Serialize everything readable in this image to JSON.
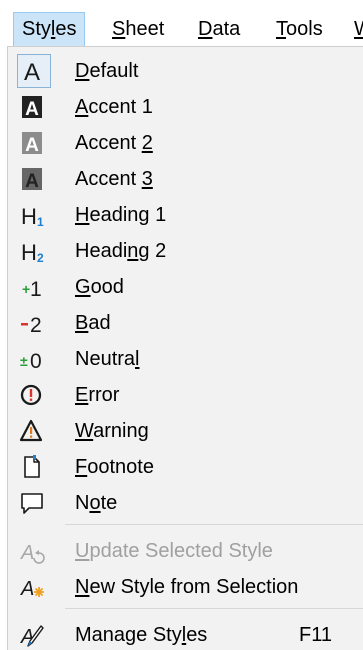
{
  "menubar": {
    "items": [
      {
        "pre": "Sty",
        "u": "l",
        "post": "es"
      },
      {
        "pre": "",
        "u": "S",
        "post": "heet"
      },
      {
        "pre": "",
        "u": "D",
        "post": "ata"
      },
      {
        "pre": "",
        "u": "T",
        "post": "ools"
      },
      {
        "pre": "",
        "u": "W",
        "post": ""
      }
    ]
  },
  "menu": {
    "items": [
      {
        "pre": "",
        "u": "D",
        "post": "efault",
        "icon": "default-style-icon"
      },
      {
        "pre": "",
        "u": "A",
        "post": "ccent 1",
        "icon": "accent1-style-icon"
      },
      {
        "pre": "Accent ",
        "u": "2",
        "post": "",
        "icon": "accent2-style-icon"
      },
      {
        "pre": "Accent ",
        "u": "3",
        "post": "",
        "icon": "accent3-style-icon"
      },
      {
        "pre": "",
        "u": "H",
        "post": "eading 1",
        "icon": "heading1-icon"
      },
      {
        "pre": "Headi",
        "u": "n",
        "post": "g 2",
        "icon": "heading2-icon"
      },
      {
        "pre": "",
        "u": "G",
        "post": "ood",
        "icon": "good-icon"
      },
      {
        "pre": "",
        "u": "B",
        "post": "ad",
        "icon": "bad-icon"
      },
      {
        "pre": "Neutra",
        "u": "l",
        "post": "",
        "icon": "neutral-icon"
      },
      {
        "pre": "",
        "u": "E",
        "post": "rror",
        "icon": "error-icon"
      },
      {
        "pre": "",
        "u": "W",
        "post": "arning",
        "icon": "warning-icon"
      },
      {
        "pre": "",
        "u": "F",
        "post": "ootnote",
        "icon": "footnote-icon"
      },
      {
        "pre": "N",
        "u": "o",
        "post": "te",
        "icon": "note-icon"
      },
      {
        "pre": "",
        "u": "U",
        "post": "pdate Selected Style",
        "icon": "update-style-icon",
        "disabled": true
      },
      {
        "pre": "",
        "u": "N",
        "post": "ew Style from Selection",
        "icon": "new-style-icon"
      },
      {
        "pre": "Manage Sty",
        "u": "l",
        "post": "es",
        "icon": "manage-styles-icon",
        "shortcut": "F11"
      }
    ]
  },
  "colors": {
    "menu_bg": "#f2f2f2",
    "active_menu_bg": "#cce4f7",
    "good_green": "#2a9d3a",
    "bad_red": "#d9352b",
    "heading_blue": "#1e7fd0",
    "disabled_text": "#a0a0a0"
  }
}
